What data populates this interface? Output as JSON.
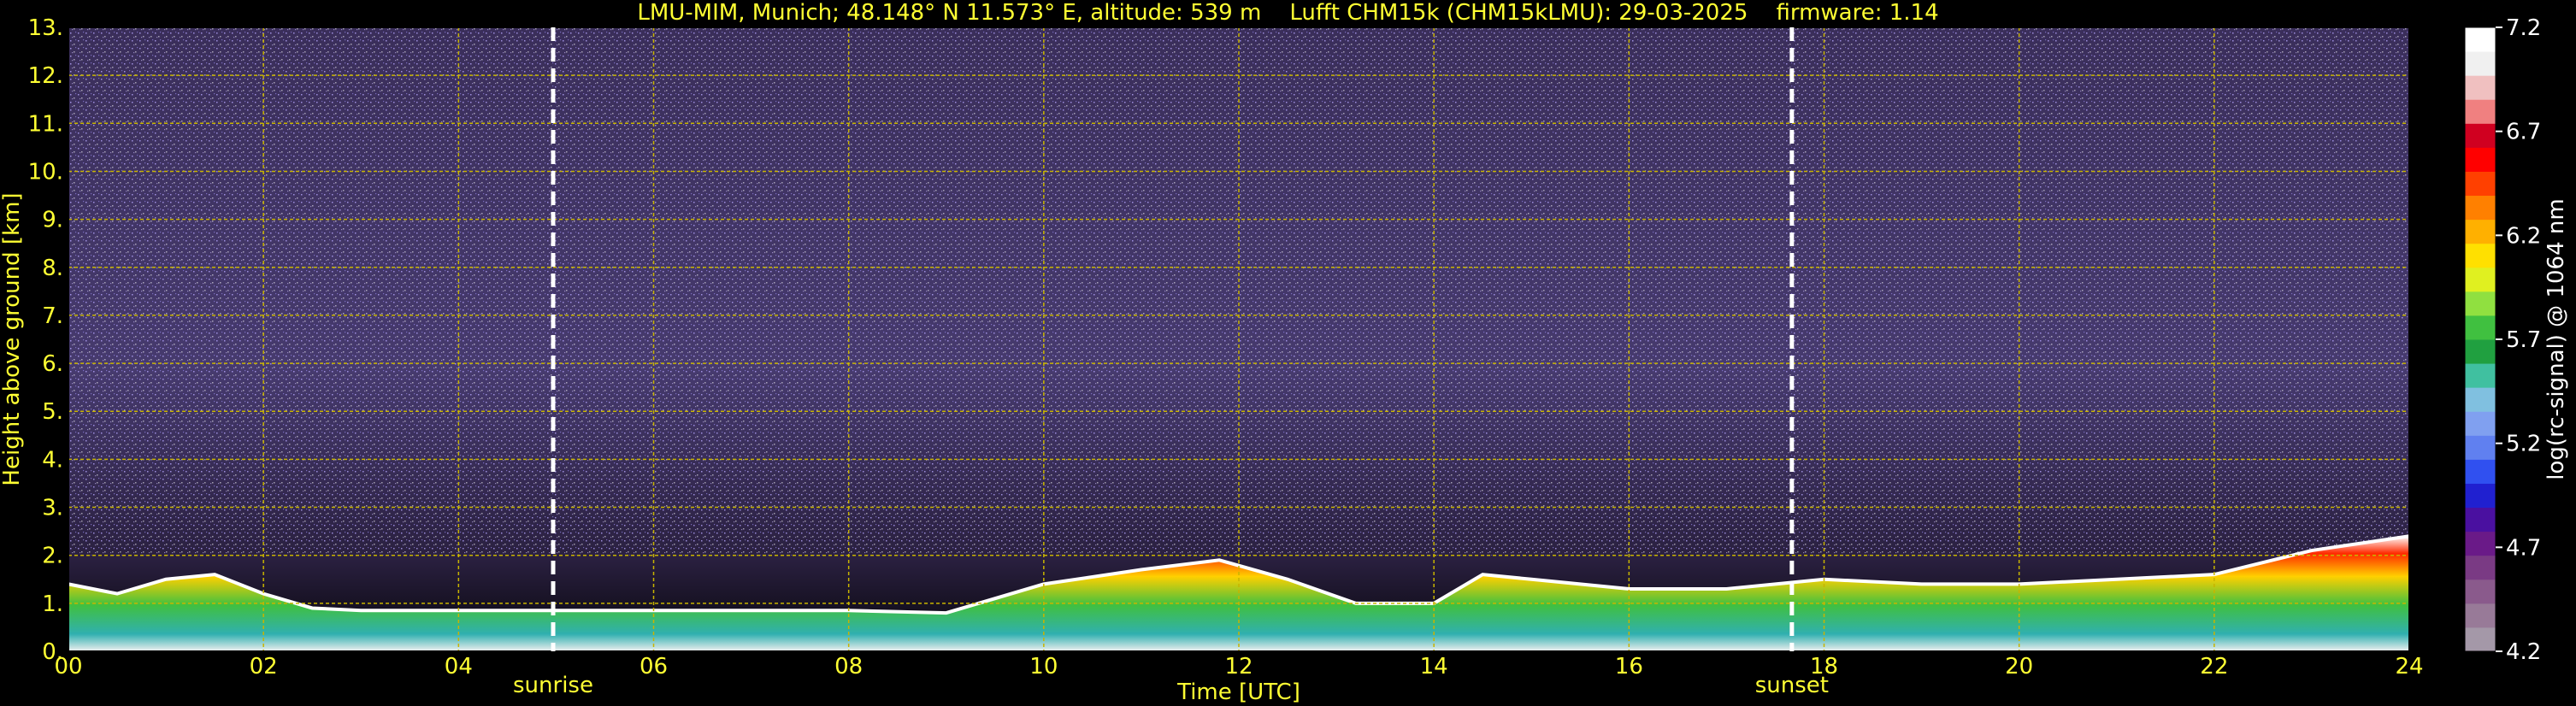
{
  "title": "LMU-MIM, Munich; 48.148° N 11.573° E, altitude: 539 m    Lufft CHM15k (CHM15kLMU): 29-03-2025    firmware: 1.14",
  "chart_data": {
    "type": "heatmap",
    "title": "LMU-MIM, Munich; 48.148° N 11.573° E, altitude: 539 m    Lufft CHM15k (CHM15kLMU): 29-03-2025    firmware: 1.14",
    "xlabel": "Time [UTC]",
    "ylabel": "Height above ground [km]",
    "xlim": [
      0,
      24
    ],
    "ylim": [
      0,
      13
    ],
    "xticks": [
      "00",
      "02",
      "04",
      "06",
      "08",
      "10",
      "12",
      "14",
      "16",
      "18",
      "20",
      "22",
      "24"
    ],
    "yticks": [
      "0.",
      "1.",
      "2.",
      "3.",
      "4.",
      "5.",
      "6.",
      "7.",
      "8.",
      "9.",
      "10.",
      "11.",
      "12.",
      "13."
    ],
    "grid": true,
    "colorbar": {
      "label": "log(rc-signal) @ 1064 nm",
      "ticks": [
        "4.2",
        "4.7",
        "5.2",
        "5.7",
        "6.2",
        "6.7",
        "7.2"
      ],
      "range": [
        4.2,
        7.2
      ],
      "colors": [
        "#a498a8",
        "#987a98",
        "#8a5a8c",
        "#7a3a84",
        "#6a1a88",
        "#4a10a0",
        "#2020d0",
        "#3050f0",
        "#6080f0",
        "#80a0f0",
        "#80c0e0",
        "#40c0a0",
        "#20a040",
        "#40c040",
        "#90e040",
        "#e0f020",
        "#ffe000",
        "#ffb000",
        "#ff8000",
        "#ff4000",
        "#ff0000",
        "#d00020",
        "#f08080",
        "#f0c0c0",
        "#f0f0f0",
        "#ffffff"
      ]
    },
    "annotations": [
      {
        "label": "sunrise",
        "x": 4.97
      },
      {
        "label": "sunset",
        "x": 17.67
      }
    ],
    "boundary_layer_top_km": [
      [
        0.0,
        1.4
      ],
      [
        0.5,
        1.2
      ],
      [
        1.0,
        1.5
      ],
      [
        1.5,
        1.6
      ],
      [
        2.0,
        1.2
      ],
      [
        2.5,
        0.9
      ],
      [
        3.0,
        0.85
      ],
      [
        4.0,
        0.85
      ],
      [
        5.0,
        0.85
      ],
      [
        6.0,
        0.85
      ],
      [
        7.0,
        0.85
      ],
      [
        8.0,
        0.85
      ],
      [
        9.0,
        0.8
      ],
      [
        10.0,
        1.4
      ],
      [
        11.0,
        1.7
      ],
      [
        11.8,
        1.9
      ],
      [
        12.5,
        1.5
      ],
      [
        13.2,
        1.0
      ],
      [
        14.0,
        1.0
      ],
      [
        14.5,
        1.6
      ],
      [
        15.0,
        1.5
      ],
      [
        16.0,
        1.3
      ],
      [
        17.0,
        1.3
      ],
      [
        18.0,
        1.5
      ],
      [
        19.0,
        1.4
      ],
      [
        20.0,
        1.4
      ],
      [
        21.0,
        1.5
      ],
      [
        22.0,
        1.6
      ],
      [
        23.0,
        2.1
      ],
      [
        24.0,
        2.4
      ]
    ]
  }
}
